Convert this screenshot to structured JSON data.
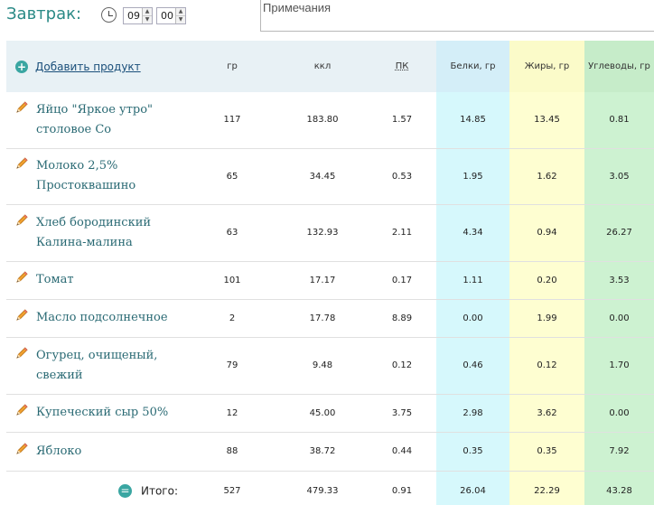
{
  "meal": {
    "title": "Завтрак:",
    "hour": "09",
    "minute": "00",
    "spin_up": "▲",
    "spin_down": "▼",
    "notes_placeholder": "Примечания"
  },
  "table": {
    "add_product": "Добавить продукт",
    "headers": {
      "gr": "гр",
      "kcal": "ккл",
      "pk": "ПК",
      "protein": "Белки, гр",
      "fat": "Жиры, гр",
      "carbs": "Углеводы, гр"
    },
    "rows": [
      {
        "name": "Яйцо \"Яркое утро\" столовое Со",
        "gr": "117",
        "kcal": "183.80",
        "pk": "1.57",
        "protein": "14.85",
        "fat": "13.45",
        "carbs": "0.81"
      },
      {
        "name": "Молоко 2,5% Простоквашино",
        "gr": "65",
        "kcal": "34.45",
        "pk": "0.53",
        "protein": "1.95",
        "fat": "1.62",
        "carbs": "3.05"
      },
      {
        "name": "Хлеб бородинский Калина-малина",
        "gr": "63",
        "kcal": "132.93",
        "pk": "2.11",
        "protein": "4.34",
        "fat": "0.94",
        "carbs": "26.27"
      },
      {
        "name": "Томат",
        "gr": "101",
        "kcal": "17.17",
        "pk": "0.17",
        "protein": "1.11",
        "fat": "0.20",
        "carbs": "3.53"
      },
      {
        "name": "Масло подсолнечное",
        "gr": "2",
        "kcal": "17.78",
        "pk": "8.89",
        "protein": "0.00",
        "fat": "1.99",
        "carbs": "0.00"
      },
      {
        "name": "Огурец, очищеный, свежий",
        "gr": "79",
        "kcal": "9.48",
        "pk": "0.12",
        "protein": "0.46",
        "fat": "0.12",
        "carbs": "1.70"
      },
      {
        "name": "Купеческий сыр 50%",
        "gr": "12",
        "kcal": "45.00",
        "pk": "3.75",
        "protein": "2.98",
        "fat": "3.62",
        "carbs": "0.00"
      },
      {
        "name": "Яблоко",
        "gr": "88",
        "kcal": "38.72",
        "pk": "0.44",
        "protein": "0.35",
        "fat": "0.35",
        "carbs": "7.92"
      }
    ],
    "total": {
      "icon": "=",
      "label": "Итого:",
      "gr": "527",
      "kcal": "479.33",
      "pk": "0.91",
      "protein": "26.04",
      "fat": "22.29",
      "carbs": "43.28"
    }
  }
}
